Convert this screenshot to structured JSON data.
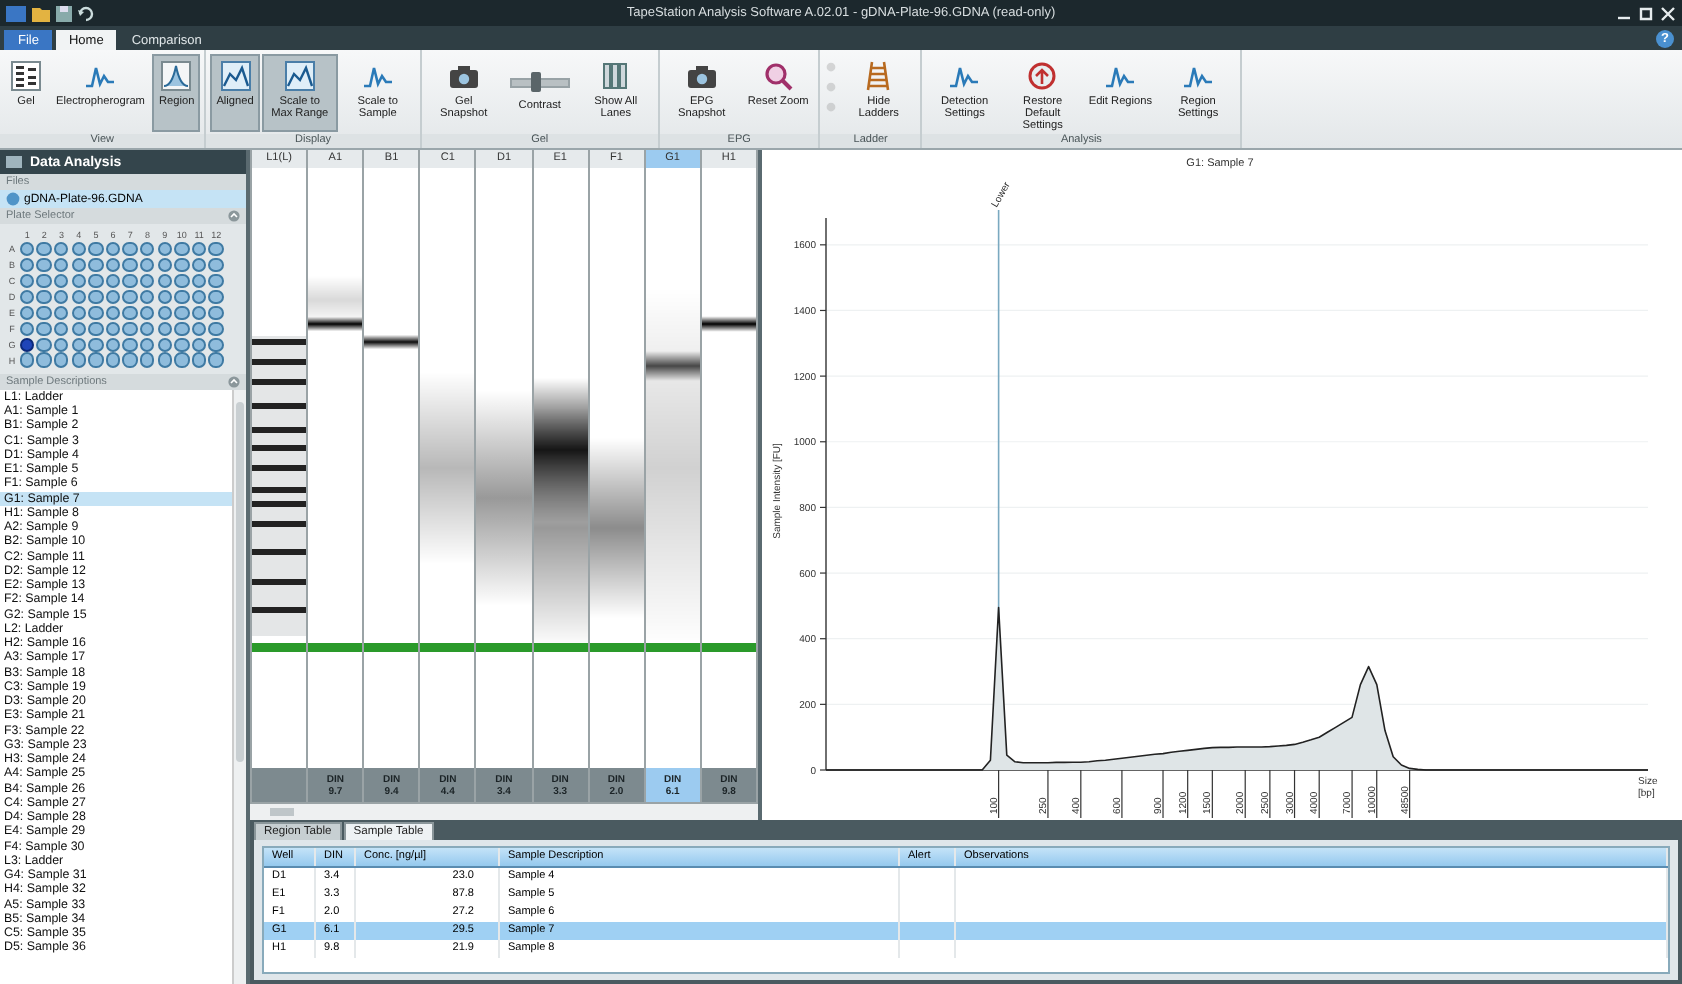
{
  "window": {
    "title": "TapeStation Analysis Software A.02.01 - gDNA-Plate-96.GDNA (read-only)"
  },
  "app_menu": {
    "label": "File"
  },
  "tabs": [
    {
      "label": "Home",
      "selected": true
    },
    {
      "label": "Comparison",
      "selected": false
    }
  ],
  "help": "?",
  "ribbon": [
    {
      "label": "View",
      "buttons": [
        {
          "kind": "large",
          "label": "Gel",
          "selected": false,
          "disabled": false
        },
        {
          "kind": "large",
          "label": "Electropherogram",
          "selected": false,
          "disabled": false
        },
        {
          "kind": "large",
          "label": "Region",
          "selected": true,
          "disabled": false
        }
      ]
    },
    {
      "label": "Display",
      "buttons": [
        {
          "kind": "large",
          "label": "Aligned",
          "selected": true,
          "disabled": false
        },
        {
          "kind": "large",
          "label": "Scale to Max Range",
          "selected": true,
          "disabled": false
        },
        {
          "kind": "large",
          "label": "Scale to Sample",
          "selected": false,
          "disabled": false
        }
      ]
    },
    {
      "label": "Gel",
      "buttons": [
        {
          "kind": "large",
          "label": "Gel Snapshot",
          "selected": false,
          "disabled": false
        },
        {
          "kind": "slider",
          "label": "Contrast",
          "level": 0.45
        },
        {
          "kind": "large",
          "label": "Show All Lanes",
          "selected": false,
          "disabled": false
        }
      ]
    },
    {
      "label": "EPG",
      "buttons": [
        {
          "kind": "large",
          "label": "EPG Snapshot",
          "selected": false,
          "disabled": false
        },
        {
          "kind": "large",
          "label": "Reset Zoom",
          "selected": false,
          "disabled": false
        }
      ]
    },
    {
      "label": "Ladder",
      "buttons": [
        {
          "kind": "small",
          "disabled": true
        },
        {
          "kind": "small",
          "disabled": true
        },
        {
          "kind": "small",
          "disabled": true
        },
        {
          "kind": "large",
          "label": "Hide Ladders",
          "selected": false,
          "disabled": false
        }
      ]
    },
    {
      "label": "Analysis",
      "buttons": [
        {
          "kind": "large",
          "label": "Detection Settings",
          "selected": false,
          "disabled": false
        },
        {
          "kind": "large",
          "label": "Restore Default Settings",
          "selected": false,
          "disabled": false
        },
        {
          "kind": "large",
          "label": "Edit Regions",
          "selected": false,
          "disabled": false
        },
        {
          "kind": "large",
          "label": "Region Settings",
          "selected": false,
          "disabled": false
        }
      ]
    }
  ],
  "left_panel": {
    "title": "Data Analysis",
    "files_label": "Files",
    "files": [
      {
        "name": "gDNA-Plate-96.GDNA",
        "selected": true
      }
    ],
    "plate_label": "Plate Selector",
    "plate": {
      "columns": [
        "1",
        "2",
        "3",
        "4",
        "5",
        "6",
        "7",
        "8",
        "9",
        "10",
        "11",
        "12"
      ],
      "rows": [
        {
          "label": "A",
          "wells": [
            {
              "selected": false
            },
            {
              "selected": false
            },
            {
              "selected": false
            },
            {
              "selected": false
            },
            {
              "selected": false
            },
            {
              "selected": false
            },
            {
              "selected": false
            },
            {
              "selected": false
            },
            {
              "selected": false
            },
            {
              "selected": false
            },
            {
              "selected": false
            },
            {
              "selected": false
            }
          ]
        },
        {
          "label": "B",
          "wells": [
            {
              "selected": false
            },
            {
              "selected": false
            },
            {
              "selected": false
            },
            {
              "selected": false
            },
            {
              "selected": false
            },
            {
              "selected": false
            },
            {
              "selected": false
            },
            {
              "selected": false
            },
            {
              "selected": false
            },
            {
              "selected": false
            },
            {
              "selected": false
            },
            {
              "selected": false
            }
          ]
        },
        {
          "label": "C",
          "wells": [
            {
              "selected": false
            },
            {
              "selected": false
            },
            {
              "selected": false
            },
            {
              "selected": false
            },
            {
              "selected": false
            },
            {
              "selected": false
            },
            {
              "selected": false
            },
            {
              "selected": false
            },
            {
              "selected": false
            },
            {
              "selected": false
            },
            {
              "selected": false
            },
            {
              "selected": false
            }
          ]
        },
        {
          "label": "D",
          "wells": [
            {
              "selected": false
            },
            {
              "selected": false
            },
            {
              "selected": false
            },
            {
              "selected": false
            },
            {
              "selected": false
            },
            {
              "selected": false
            },
            {
              "selected": false
            },
            {
              "selected": false
            },
            {
              "selected": false
            },
            {
              "selected": false
            },
            {
              "selected": false
            },
            {
              "selected": false
            }
          ]
        },
        {
          "label": "E",
          "wells": [
            {
              "selected": false
            },
            {
              "selected": false
            },
            {
              "selected": false
            },
            {
              "selected": false
            },
            {
              "selected": false
            },
            {
              "selected": false
            },
            {
              "selected": false
            },
            {
              "selected": false
            },
            {
              "selected": false
            },
            {
              "selected": false
            },
            {
              "selected": false
            },
            {
              "selected": false
            }
          ]
        },
        {
          "label": "F",
          "wells": [
            {
              "selected": false
            },
            {
              "selected": false
            },
            {
              "selected": false
            },
            {
              "selected": false
            },
            {
              "selected": false
            },
            {
              "selected": false
            },
            {
              "selected": false
            },
            {
              "selected": false
            },
            {
              "selected": false
            },
            {
              "selected": false
            },
            {
              "selected": false
            },
            {
              "selected": false
            }
          ]
        },
        {
          "label": "G",
          "wells": [
            {
              "selected": true
            },
            {
              "selected": false
            },
            {
              "selected": false
            },
            {
              "selected": false
            },
            {
              "selected": false
            },
            {
              "selected": false
            },
            {
              "selected": false
            },
            {
              "selected": false
            },
            {
              "selected": false
            },
            {
              "selected": false
            },
            {
              "selected": false
            },
            {
              "selected": false
            }
          ]
        },
        {
          "label": "H",
          "wells": [
            {
              "selected": false
            },
            {
              "selected": false
            },
            {
              "selected": false
            },
            {
              "selected": false
            },
            {
              "selected": false
            },
            {
              "selected": false
            },
            {
              "selected": false
            },
            {
              "selected": false
            },
            {
              "selected": false
            },
            {
              "selected": false
            },
            {
              "selected": false
            },
            {
              "selected": false
            }
          ]
        }
      ]
    },
    "samples_label": "Sample Descriptions",
    "samples": [
      {
        "label": "L1: Ladder",
        "selected": false
      },
      {
        "label": "A1: Sample 1",
        "selected": false
      },
      {
        "label": "B1: Sample 2",
        "selected": false
      },
      {
        "label": "C1: Sample 3",
        "selected": false
      },
      {
        "label": "D1: Sample 4",
        "selected": false
      },
      {
        "label": "E1: Sample 5",
        "selected": false
      },
      {
        "label": "F1: Sample 6",
        "selected": false
      },
      {
        "label": "G1: Sample 7",
        "selected": true
      },
      {
        "label": "H1: Sample 8",
        "selected": false
      },
      {
        "label": "A2: Sample 9",
        "selected": false
      },
      {
        "label": "B2: Sample 10",
        "selected": false
      },
      {
        "label": "C2: Sample 11",
        "selected": false
      },
      {
        "label": "D2: Sample 12",
        "selected": false
      },
      {
        "label": "E2: Sample 13",
        "selected": false
      },
      {
        "label": "F2: Sample 14",
        "selected": false
      },
      {
        "label": "G2: Sample 15",
        "selected": false
      },
      {
        "label": "L2: Ladder",
        "selected": false
      },
      {
        "label": "H2: Sample 16",
        "selected": false
      },
      {
        "label": "A3: Sample 17",
        "selected": false
      },
      {
        "label": "B3: Sample 18",
        "selected": false
      },
      {
        "label": "C3: Sample 19",
        "selected": false
      },
      {
        "label": "D3: Sample 20",
        "selected": false
      },
      {
        "label": "E3: Sample 21",
        "selected": false
      },
      {
        "label": "F3: Sample 22",
        "selected": false
      },
      {
        "label": "G3: Sample 23",
        "selected": false
      },
      {
        "label": "H3: Sample 24",
        "selected": false
      },
      {
        "label": "A4: Sample 25",
        "selected": false
      },
      {
        "label": "B4: Sample 26",
        "selected": false
      },
      {
        "label": "C4: Sample 27",
        "selected": false
      },
      {
        "label": "D4: Sample 28",
        "selected": false
      },
      {
        "label": "E4: Sample 29",
        "selected": false
      },
      {
        "label": "F4: Sample 30",
        "selected": false
      },
      {
        "label": "L3: Ladder",
        "selected": false
      },
      {
        "label": "G4: Sample 31",
        "selected": false
      },
      {
        "label": "H4: Sample 32",
        "selected": false
      },
      {
        "label": "A5: Sample 33",
        "selected": false
      },
      {
        "label": "B5: Sample 34",
        "selected": false
      },
      {
        "label": "C5: Sample 35",
        "selected": false
      },
      {
        "label": "D5: Sample 36",
        "selected": false
      }
    ]
  },
  "gel": {
    "lanes": [
      {
        "kind": "ladder",
        "label": "L1(L)",
        "selected": false
      },
      {
        "kind": "sample",
        "label": "A1",
        "selected": false,
        "din_label": "DIN",
        "din": "9.7"
      },
      {
        "kind": "sample",
        "label": "B1",
        "selected": false,
        "din_label": "DIN",
        "din": "9.4"
      },
      {
        "kind": "sample",
        "label": "C1",
        "selected": false,
        "din_label": "DIN",
        "din": "4.4"
      },
      {
        "kind": "sample",
        "label": "D1",
        "selected": false,
        "din_label": "DIN",
        "din": "3.4"
      },
      {
        "kind": "sample",
        "label": "E1",
        "selected": false,
        "din_label": "DIN",
        "din": "3.3"
      },
      {
        "kind": "sample",
        "label": "F1",
        "selected": false,
        "din_label": "DIN",
        "din": "2.0"
      },
      {
        "kind": "sample",
        "label": "G1",
        "selected": true,
        "din_label": "DIN",
        "din": "6.1"
      },
      {
        "kind": "sample",
        "label": "H1",
        "selected": false,
        "din_label": "DIN",
        "din": "9.8"
      }
    ]
  },
  "epg": {
    "chart_data": {
      "type": "area",
      "title": "G1: Sample 7",
      "xlabel": "Size [bp]",
      "ylabel": "Sample Intensity [FU]",
      "categories": [
        null,
        null,
        null,
        null,
        null,
        null,
        null,
        null,
        null,
        null,
        null,
        null,
        null,
        null,
        null,
        null,
        null,
        null,
        null,
        null,
        null,
        "100",
        null,
        null,
        null,
        null,
        null,
        "250",
        null,
        null,
        null,
        "400",
        null,
        null,
        null,
        null,
        "600",
        null,
        null,
        null,
        null,
        "900",
        null,
        null,
        "1200",
        null,
        null,
        "1500",
        null,
        null,
        null,
        "2000",
        null,
        null,
        "2500",
        null,
        null,
        "3000",
        null,
        null,
        "4000",
        null,
        null,
        null,
        "7000",
        null,
        null,
        "10000",
        null,
        null,
        null,
        "48500",
        null,
        null,
        null,
        null,
        null,
        null,
        null,
        null,
        null,
        null,
        null,
        null,
        null,
        null,
        null,
        null,
        null,
        null,
        null,
        null,
        null,
        null,
        null,
        null,
        null,
        null,
        null,
        null,
        null
      ],
      "series": [
        {
          "color": "#222222",
          "values": [
            0,
            0,
            0,
            0,
            0,
            0,
            0,
            0,
            0,
            0,
            0,
            0,
            0,
            0,
            0,
            0,
            0,
            0,
            0,
            0,
            30,
            495,
            45,
            25,
            22,
            22,
            22,
            22,
            23,
            23,
            24,
            24,
            25,
            28,
            30,
            33,
            36,
            39,
            42,
            45,
            48,
            50,
            54,
            57,
            60,
            63,
            66,
            68,
            69,
            69,
            70,
            70,
            70,
            70,
            71,
            73,
            75,
            78,
            85,
            92,
            100,
            115,
            130,
            145,
            160,
            260,
            315,
            260,
            120,
            40,
            15,
            5,
            2,
            0,
            0,
            0,
            0,
            0,
            0,
            0,
            0,
            0,
            0,
            0,
            0,
            0,
            0,
            0,
            0,
            0,
            0,
            0,
            0,
            0,
            0,
            0,
            0,
            0,
            0,
            0,
            0
          ]
        }
      ],
      "grid": true,
      "ylim": [
        0,
        1700
      ],
      "yticks": [
        0,
        200,
        400,
        600,
        800,
        1000,
        1200,
        1400,
        1600
      ],
      "annotations": [
        {
          "x": "100",
          "text": "Lower"
        }
      ]
    }
  },
  "bottom_tabs": [
    {
      "label": "Region Table",
      "selected": false
    },
    {
      "label": "Sample Table",
      "selected": true
    }
  ],
  "table": {
    "columns": [
      "Well",
      "DIN",
      "Conc. [ng/µl]",
      "Sample Description",
      "Alert",
      "Observations"
    ],
    "rows": [
      {
        "cells": [
          "D1",
          "3.4",
          "23.0",
          "Sample 4",
          "",
          ""
        ],
        "selected": false
      },
      {
        "cells": [
          "E1",
          "3.3",
          "87.8",
          "Sample 5",
          "",
          ""
        ],
        "selected": false
      },
      {
        "cells": [
          "F1",
          "2.0",
          "27.2",
          "Sample 6",
          "",
          ""
        ],
        "selected": false
      },
      {
        "cells": [
          "G1",
          "6.1",
          "29.5",
          "Sample 7",
          "",
          ""
        ],
        "selected": true
      },
      {
        "cells": [
          "H1",
          "9.8",
          "21.9",
          "Sample 8",
          "",
          ""
        ],
        "selected": false
      }
    ]
  }
}
